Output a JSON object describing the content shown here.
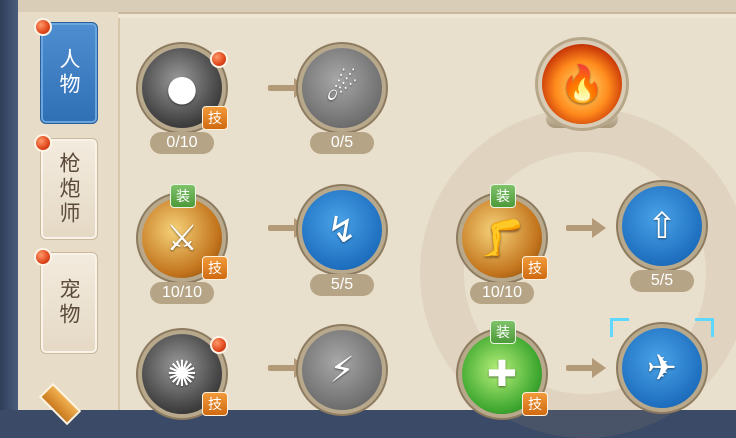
{
  "tabs": [
    {
      "label": "人物",
      "active": true
    },
    {
      "label": "枪炮师",
      "active": false
    },
    {
      "label": "宠物",
      "active": false
    }
  ],
  "tags": {
    "skill": "技",
    "equip": "装"
  },
  "counts": {
    "r1a": "0/10",
    "r1b": "0/5",
    "r2a": "10/10",
    "r2b": "5/5",
    "r2c": "10/10",
    "r2d": "5/5"
  },
  "icons": {
    "r1a": "bomb-icon",
    "r1b": "comet-icon",
    "fire": "fire-orb-icon",
    "r2a": "blade-slash-icon",
    "r2b": "dash-strike-icon",
    "r2c": "leap-kick-icon",
    "r2d": "boot-up-icon",
    "r3a": "spark-burst-icon",
    "r3b": "lightning-icon",
    "r3c": "heal-potion-icon",
    "r3d": "drone-icon"
  },
  "colors": {
    "active_tab": "#2f6fb4",
    "badge": "#e0461c",
    "selection": "#5fd8ff"
  }
}
